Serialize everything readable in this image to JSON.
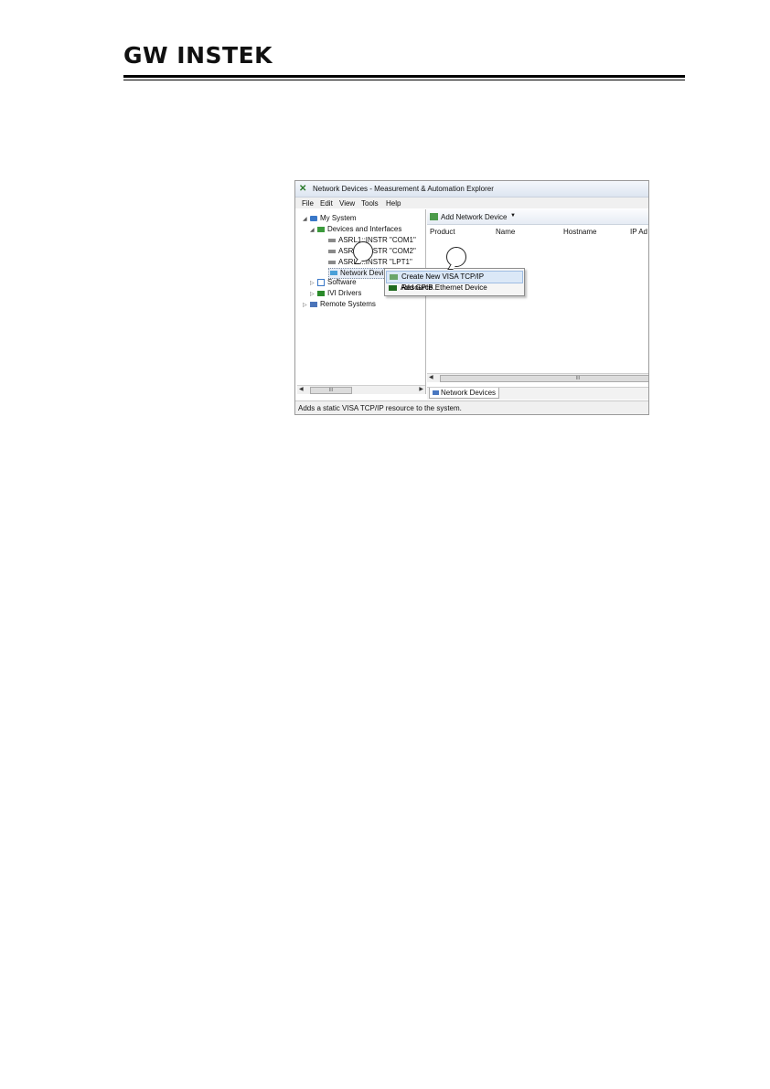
{
  "header": {
    "logo_text": "GW INSTEK"
  },
  "window": {
    "title": "Network Devices - Measurement & Automation Explorer",
    "menu": [
      "File",
      "Edit",
      "View",
      "Tools",
      "Help"
    ],
    "tree": {
      "my_system": "My System",
      "devices_and_interfaces": "Devices and Interfaces",
      "ports": [
        "ASRL1::INSTR \"COM1\"",
        "ASRL2::INSTR \"COM2\"",
        "ASRL3::INSTR \"LPT1\""
      ],
      "network_devices": "Network Devices",
      "software": "Software",
      "ivi_drivers": "IVI Drivers",
      "remote_systems": "Remote Systems"
    },
    "toolbar": {
      "add_network_device": "Add Network Device"
    },
    "columns": [
      "Product",
      "Name",
      "Hostname",
      "IP Ad"
    ],
    "bottom_tab": "Network Devices",
    "status": "Adds a static VISA TCP/IP resource to the system.",
    "scroll_thumb": "III"
  },
  "context_menu": {
    "items": [
      "Create New VISA TCP/IP Resource...",
      "Add GPIB Ethernet Device"
    ]
  }
}
